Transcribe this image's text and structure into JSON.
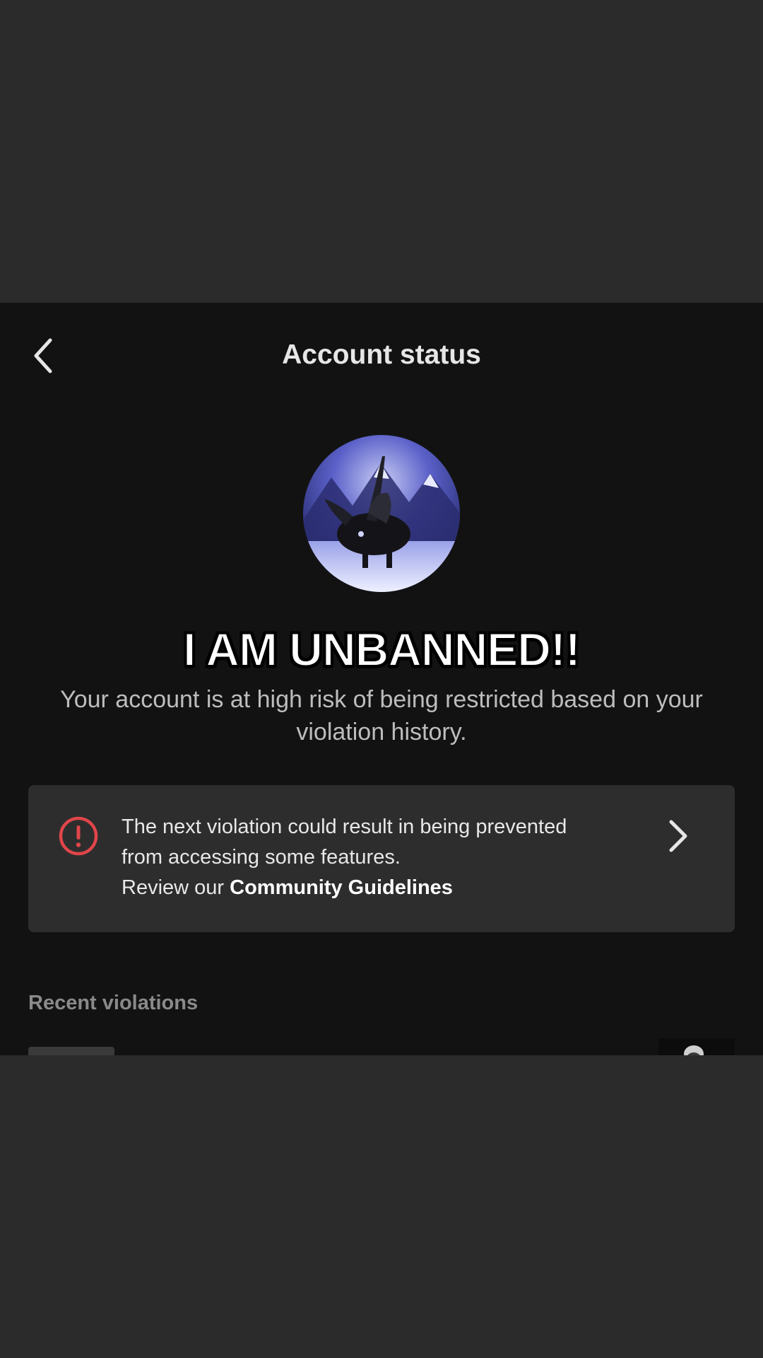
{
  "header": {
    "title": "Account status",
    "back_icon": "chevron-left-icon"
  },
  "overlay": {
    "caption": "I AM UNBANNED!!"
  },
  "status": {
    "message": "Your account is at high risk of being restricted based on your violation history."
  },
  "warning_card": {
    "icon": "alert-circle-icon",
    "line1": "The next violation could result in being prevented from accessing some features.",
    "review_prefix": "Review our ",
    "review_link": "Community Guidelines",
    "chevron_icon": "chevron-right-icon",
    "icon_color": "#e0464a"
  },
  "recent": {
    "title": "Recent violations"
  },
  "colors": {
    "background": "#121212",
    "frame": "#2b2b2b",
    "card": "#2d2d2d",
    "alert": "#e0464a"
  }
}
